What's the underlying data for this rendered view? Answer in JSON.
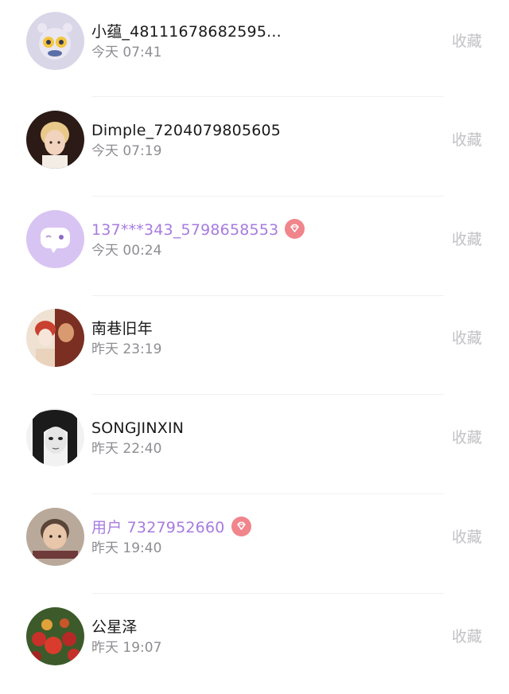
{
  "contacts": [
    {
      "name": "小蕴_48111678682595...",
      "time": "今天 07:41",
      "action": "收藏",
      "vip": false,
      "avatar": "avatar-cartoon-bear"
    },
    {
      "name": "Dimple_7204079805605",
      "time": "今天 07:19",
      "action": "收藏",
      "vip": false,
      "avatar": "avatar-portrait-blonde"
    },
    {
      "name": "137***343_5798658553",
      "time": "今天 00:24",
      "action": "收藏",
      "vip": true,
      "avatar": "avatar-default-chat-bubble"
    },
    {
      "name": "南巷旧年",
      "time": "昨天 23:19",
      "action": "收藏",
      "vip": false,
      "avatar": "avatar-anime-couple"
    },
    {
      "name": "SONGJINXIN",
      "time": "昨天 22:40",
      "action": "收藏",
      "vip": false,
      "avatar": "avatar-manga-girl"
    },
    {
      "name": "用户 7327952660",
      "time": "昨天 19:40",
      "action": "收藏",
      "vip": true,
      "avatar": "avatar-baby-photo"
    },
    {
      "name": "公星泽",
      "time": "昨天 19:07",
      "action": "收藏",
      "vip": false,
      "avatar": "avatar-red-flowers"
    }
  ],
  "colors": {
    "vip_name": "#a77be0",
    "vip_badge": "#f0858c",
    "muted": "#8e8e93",
    "action": "#c2c2c6"
  }
}
